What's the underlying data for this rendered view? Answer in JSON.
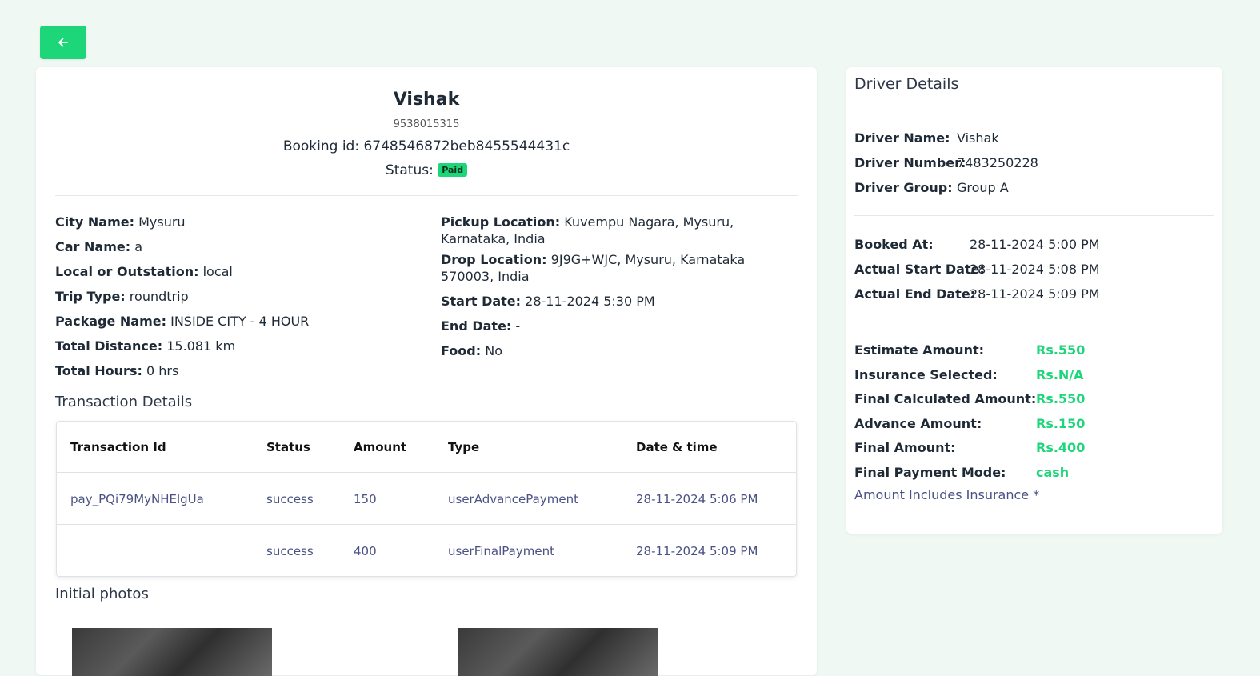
{
  "back_icon": "arrow-left-icon",
  "header": {
    "name": "Vishak",
    "phone": "9538015315",
    "booking_label": "Booking id:",
    "booking_id": "6748546872beb8455544431c",
    "status_label": "Status:",
    "status_badge": "Paid"
  },
  "trip": {
    "city_label": "City Name:",
    "city": "Mysuru",
    "car_label": "Car Name:",
    "car": "a",
    "local_label": "Local or Outstation:",
    "local": "local",
    "trip_type_label": "Trip Type:",
    "trip_type": "roundtrip",
    "package_label": "Package Name:",
    "package": "INSIDE CITY - 4 HOUR",
    "distance_label": "Total Distance:",
    "distance": "15.081 km",
    "hours_label": "Total Hours:",
    "hours": "0 hrs",
    "pickup_label": "Pickup Location:",
    "pickup": "Kuvempu Nagara, Mysuru, Karnataka, India",
    "drop_label": "Drop Location:",
    "drop": "9J9G+WJC, Mysuru, Karnataka 570003, India",
    "start_label": "Start Date:",
    "start": "28-11-2024 5:30 PM",
    "end_label": "End Date:",
    "end": "-",
    "food_label": "Food:",
    "food": "No"
  },
  "transactions": {
    "title": "Transaction Details",
    "headers": [
      "Transaction Id",
      "Status",
      "Amount",
      "Type",
      "Date & time"
    ],
    "rows": [
      [
        "pay_PQi79MyNHElgUa",
        "success",
        "150",
        "userAdvancePayment",
        "28-11-2024 5:06 PM"
      ],
      [
        "",
        "success",
        "400",
        "userFinalPayment",
        "28-11-2024 5:09 PM"
      ]
    ]
  },
  "photos": {
    "title": "Initial photos"
  },
  "driver": {
    "title": "Driver Details",
    "name_label": "Driver Name:",
    "name": "Vishak",
    "number_label": "Driver Number:",
    "number": "7483250228",
    "group_label": "Driver Group:",
    "group": "Group A",
    "booked_label": "Booked At:",
    "booked": "28-11-2024 5:00 PM",
    "actual_start_label": "Actual Start Date:",
    "actual_start": "28-11-2024 5:08 PM",
    "actual_end_label": "Actual End Date:",
    "actual_end": "28-11-2024 5:09 PM",
    "estimate_label": "Estimate Amount:",
    "estimate": "Rs.550",
    "insurance_label": "Insurance Selected:",
    "insurance": "Rs.N/A",
    "final_calc_label": "Final Calculated Amount:",
    "final_calc": "Rs.550",
    "advance_label": "Advance Amount:",
    "advance": "Rs.150",
    "final_label": "Final Amount:",
    "final": "Rs.400",
    "mode_label": "Final Payment Mode:",
    "mode": "cash",
    "note": "Amount Includes Insurance *"
  },
  "colors": {
    "accent": "#1ed67a",
    "background": "#f0f8f4",
    "link": "#4a5185"
  }
}
